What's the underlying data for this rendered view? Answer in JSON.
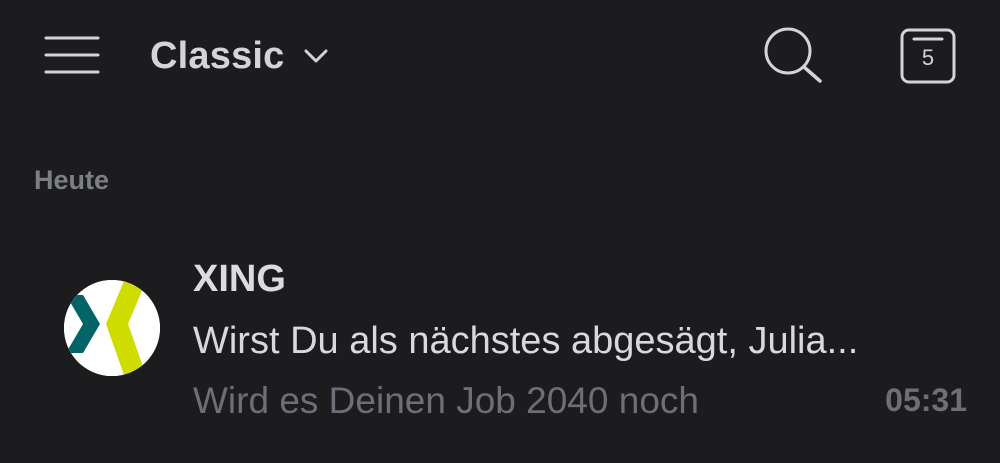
{
  "header": {
    "view_label": "Classic",
    "menu_icon": "hamburger-menu-icon",
    "dropdown_icon": "chevron-down-icon",
    "search_icon": "search-icon",
    "calendar_icon": "calendar-icon",
    "calendar_day": "5"
  },
  "sections": [
    {
      "title": "Heute",
      "items": [
        {
          "sender": "XING",
          "subject": "Wirst Du als nächstes abgesägt, Julia...",
          "preview": "Wird es Deinen Job 2040 noch",
          "time": "05:31",
          "avatar": "xing-logo",
          "colors": {
            "logo_teal": "#026466",
            "logo_lime": "#cfdc00"
          }
        }
      ]
    }
  ],
  "colors": {
    "background": "#1c1c1e",
    "primary_text": "#d9d9dc",
    "secondary_text": "#6d6f78"
  }
}
